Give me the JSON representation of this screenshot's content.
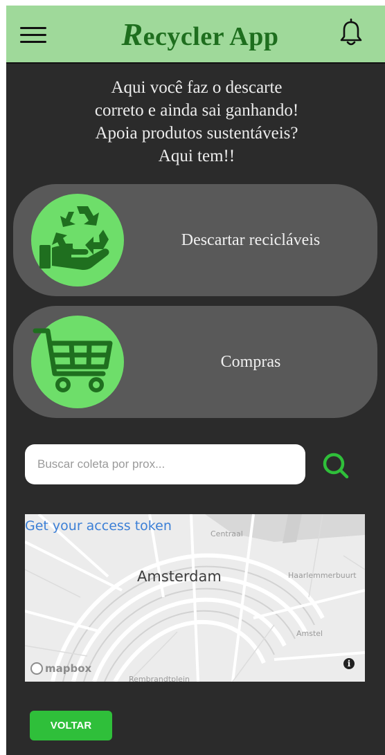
{
  "header": {
    "title_initial": "R",
    "title_rest": "ecycler App",
    "menu_icon": "hamburger-menu-icon",
    "bell_icon": "bell-icon"
  },
  "intro": {
    "lines": [
      "Aqui você faz o descarte",
      "correto e ainda sai ganhando!",
      "Apoia produtos sustentáveis?",
      "Aqui tem!!"
    ]
  },
  "cards": [
    {
      "label": "Descartar recicláveis",
      "icon": "recycle-hand-icon"
    },
    {
      "label": "Compras",
      "icon": "shopping-cart-icon"
    }
  ],
  "search": {
    "placeholder": "Buscar coleta por prox...",
    "icon": "search-icon"
  },
  "map": {
    "token_link": "Get your access token",
    "city": "Amsterdam",
    "labels": [
      "Centraal",
      "Haarlemmerbuurt",
      "Rembrandtplein",
      "Amstel"
    ],
    "logo": "mapbox",
    "info": "i"
  },
  "back_button": {
    "label": "VOLTAR"
  },
  "colors": {
    "header_bg": "#9fd99a",
    "brand_green": "#1e6e1e",
    "page_bg": "#2b2b2b",
    "card_bg": "#595959",
    "circle_green": "#6ede6a",
    "search_icon": "#2fbf3a",
    "button_green": "#2fbf3a",
    "link_blue": "#3b7fd6"
  }
}
